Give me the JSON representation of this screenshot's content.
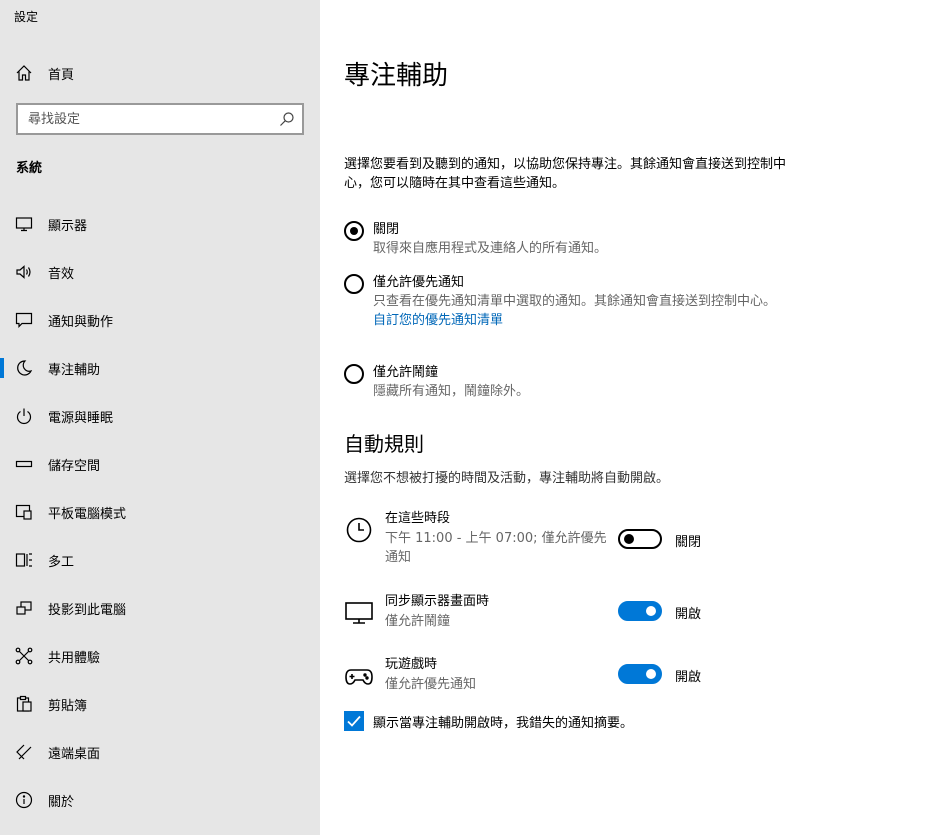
{
  "app_title": "設定",
  "search": {
    "placeholder": "尋找設定"
  },
  "home_label": "首頁",
  "section_label": "系統",
  "sidebar": {
    "items": [
      {
        "label": "顯示器",
        "icon": "monitor-icon"
      },
      {
        "label": "音效",
        "icon": "speaker-icon"
      },
      {
        "label": "通知與動作",
        "icon": "notification-icon"
      },
      {
        "label": "專注輔助",
        "icon": "moon-icon",
        "active": true
      },
      {
        "label": "電源與睡眠",
        "icon": "power-icon"
      },
      {
        "label": "儲存空間",
        "icon": "storage-icon"
      },
      {
        "label": "平板電腦模式",
        "icon": "tablet-icon"
      },
      {
        "label": "多工",
        "icon": "multitask-icon"
      },
      {
        "label": "投影到此電腦",
        "icon": "project-icon"
      },
      {
        "label": "共用體驗",
        "icon": "shared-icon"
      },
      {
        "label": "剪貼簿",
        "icon": "clipboard-icon"
      },
      {
        "label": "遠端桌面",
        "icon": "remote-desktop-icon"
      },
      {
        "label": "關於",
        "icon": "info-icon"
      }
    ]
  },
  "main": {
    "title": "專注輔助",
    "description": "選擇您要看到及聽到的通知，以協助您保持專注。其餘通知會直接送到控制中心，您可以隨時在其中查看這些通知。",
    "options": [
      {
        "title": "關閉",
        "subtitle": "取得來自應用程式及連絡人的所有通知。",
        "checked": true
      },
      {
        "title": "僅允許優先通知",
        "subtitle": "只查看在優先通知清單中選取的通知。其餘通知會直接送到控制中心。",
        "link": "自訂您的優先通知清單",
        "checked": false
      },
      {
        "title": "僅允許鬧鐘",
        "subtitle": "隱藏所有通知，鬧鐘除外。",
        "checked": false
      }
    ],
    "auto_rules_heading": "自動規則",
    "auto_rules_description": "選擇您不想被打擾的時間及活動，專注輔助將自動開啟。",
    "rules": [
      {
        "title": "在這些時段",
        "subtitle": "下午 11:00 - 上午 07:00; 僅允許優先通知",
        "toggle_state": "關閉",
        "on": false,
        "icon": "clock-icon"
      },
      {
        "title": "同步顯示器畫面時",
        "subtitle": "僅允許鬧鐘",
        "toggle_state": "開啟",
        "on": true,
        "icon": "monitor-icon"
      },
      {
        "title": "玩遊戲時",
        "subtitle": "僅允許優先通知",
        "toggle_state": "開啟",
        "on": true,
        "icon": "gamepad-icon"
      }
    ],
    "summary_checkbox_label": "顯示當專注輔助開啟時，我錯失的通知摘要。",
    "summary_checked": true
  },
  "colors": {
    "accent": "#0078d7",
    "link": "#0067b8",
    "sidebar_bg": "#e6e6e6"
  }
}
